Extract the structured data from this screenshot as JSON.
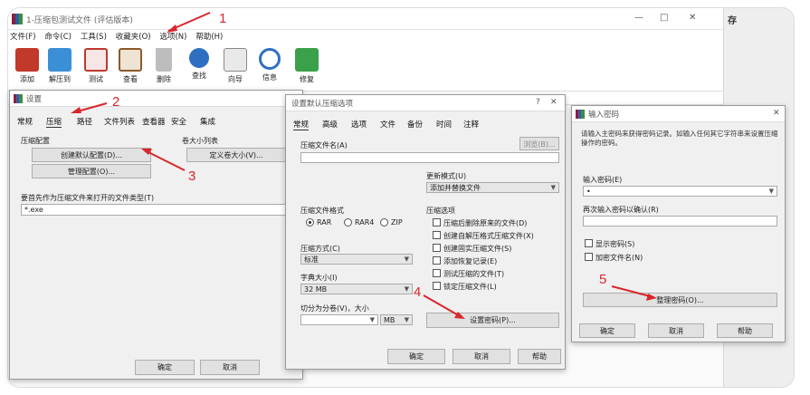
{
  "main_window": {
    "title": "1-压缩包测试文件 (评估版本)",
    "side_text": "存",
    "controls": {
      "minimize": "—",
      "maximize": "□",
      "close": "✕"
    },
    "menu": [
      "文件(F)",
      "命令(C)",
      "工具(S)",
      "收藏夹(O)",
      "选项(N)",
      "帮助(H)"
    ],
    "toolbar": [
      {
        "label": "添加",
        "icon": "add-archive-icon",
        "color": "#c0392b"
      },
      {
        "label": "解压到",
        "icon": "extract-folder-icon",
        "color": "#3a8fd6"
      },
      {
        "label": "测试",
        "icon": "test-clipboard-icon",
        "color": "#c0392b"
      },
      {
        "label": "查看",
        "icon": "view-book-icon",
        "color": "#8a5a2b"
      },
      {
        "label": "删除",
        "icon": "trash-icon",
        "color": "#666666"
      },
      {
        "label": "查找",
        "icon": "magnifier-icon",
        "color": "#2e6fc2"
      },
      {
        "label": "向导",
        "icon": "wand-icon",
        "color": "#555555"
      },
      {
        "label": "信息",
        "icon": "info-icon",
        "color": "#2e6fc2"
      },
      {
        "label": "修复",
        "icon": "repair-kit-icon",
        "color": "#3aa14a"
      }
    ]
  },
  "settings_dialog": {
    "title": "设置",
    "tabs": [
      "常规",
      "压缩",
      "路径",
      "文件列表",
      "查看器",
      "安全",
      "集成"
    ],
    "group_label": "压缩配置",
    "size_group_label": "卷大小列表",
    "create_default_button": "创建默认配置(D)...",
    "organize_button": "管理配置(O)...",
    "define_size_button": "定义卷大小(V)...",
    "filetypes_label": "要首先作为压缩文件来打开的文件类型(T)",
    "filetypes_value": "*.exe",
    "ok": "确定",
    "cancel": "取消"
  },
  "default_archive_dialog": {
    "title": "设置默认压缩选项",
    "help_mark": "?",
    "close": "✕",
    "tabs": [
      "常规",
      "高级",
      "选项",
      "文件",
      "备份",
      "时间",
      "注释"
    ],
    "archive_name_label": "压缩文件名(A)",
    "browse_button": "浏览(B)...",
    "update_mode_label": "更新模式(U)",
    "update_mode_value": "添加并替换文件",
    "format_label": "压缩文件格式",
    "formats": [
      "RAR",
      "RAR4",
      "ZIP"
    ],
    "format_selected": "RAR",
    "method_label": "压缩方式(C)",
    "method_value": "标准",
    "dict_label": "字典大小(I)",
    "dict_value": "32 MB",
    "split_label": "切分为分卷(V)，大小",
    "split_unit": "MB",
    "options_label": "压缩选项",
    "options": [
      "压缩后删除原来的文件(D)",
      "创建自解压格式压缩文件(X)",
      "创建固实压缩文件(S)",
      "添加恢复记录(E)",
      "测试压缩的文件(T)",
      "锁定压缩文件(L)"
    ],
    "set_password_button": "设置密码(P)...",
    "ok": "确定",
    "cancel": "取消",
    "help": "帮助"
  },
  "password_dialog": {
    "title": "输入密码",
    "close": "✕",
    "description": "请输入主密码来获得密码记录。如输入任何其它字符串来设置压缩操作的密码。",
    "password_label": "输入密码(E)",
    "password_value": "•",
    "confirm_label": "再次输入密码以确认(R)",
    "show_password": "显示密码(S)",
    "encrypt_names": "加密文件名(N)",
    "organize_button": "整理密码(O)...",
    "ok": "确定",
    "cancel": "取消",
    "help": "帮助"
  },
  "annotations": [
    "1",
    "2",
    "3",
    "4",
    "5"
  ],
  "colors": {
    "annotation_red": "#d9262c"
  }
}
